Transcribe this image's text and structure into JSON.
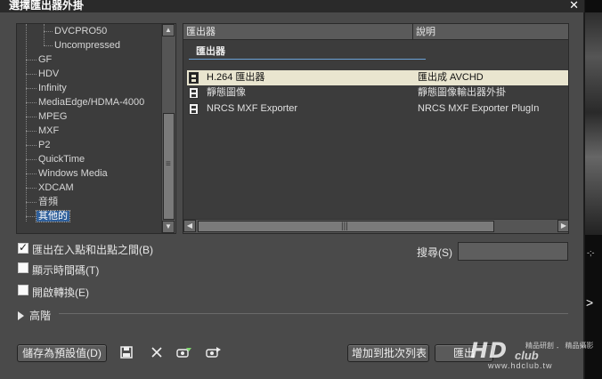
{
  "window": {
    "title": "選擇匯出器外掛",
    "close_glyph": "✕"
  },
  "tree": {
    "items": [
      {
        "label": "DVCPRO50",
        "level": 2
      },
      {
        "label": "Uncompressed",
        "level": 2
      },
      {
        "label": "GF",
        "level": 1
      },
      {
        "label": "HDV",
        "level": 1
      },
      {
        "label": "Infinity",
        "level": 1
      },
      {
        "label": "MediaEdge/HDMA-4000",
        "level": 1
      },
      {
        "label": "MPEG",
        "level": 1
      },
      {
        "label": "MXF",
        "level": 1
      },
      {
        "label": "P2",
        "level": 1
      },
      {
        "label": "QuickTime",
        "level": 1
      },
      {
        "label": "Windows Media",
        "level": 1
      },
      {
        "label": "XDCAM",
        "level": 1
      },
      {
        "label": "音頻",
        "level": 1
      },
      {
        "label": "其他的",
        "level": 1,
        "selected": true
      }
    ]
  },
  "list": {
    "columns": [
      "匯出器",
      "說明"
    ],
    "group": "匯出器",
    "rows": [
      {
        "name": "H.264 匯出器",
        "desc": "匯出成 AVCHD",
        "selected": true,
        "icon": "film-icon"
      },
      {
        "name": "靜態圖像",
        "desc": "靜態圖像輸出器外掛",
        "selected": false,
        "icon": "film-icon"
      },
      {
        "name": "NRCS MXF Exporter",
        "desc": "NRCS MXF Exporter PlugIn",
        "selected": false,
        "icon": "film-icon"
      }
    ],
    "hscroll_grip": "|||"
  },
  "options": {
    "export_in_out": {
      "label": "匯出在入點和出點之間(B)",
      "checked": true
    },
    "show_timecode": {
      "label": "顯示時間碼(T)",
      "checked": false
    },
    "enable_conversion": {
      "label": "開啟轉換(E)",
      "checked": false
    }
  },
  "search": {
    "label": "搜尋(S)",
    "value": ""
  },
  "advanced": {
    "label": "高階"
  },
  "buttons": {
    "save_preset": "儲存為預設值(D)",
    "add_to_batch": "增加到批次列表",
    "export": "匯出"
  },
  "toolbar_icons": [
    "save-icon",
    "delete-icon",
    "import-preset-icon",
    "export-preset-icon"
  ],
  "background": {
    "strip_text": "-;-",
    "strip_arrow": ">",
    "watermark": {
      "main": "HD",
      "club": "club",
      "sub": "精品研創 ． 精品攝影",
      "url": "www.hdclub.tw"
    }
  }
}
